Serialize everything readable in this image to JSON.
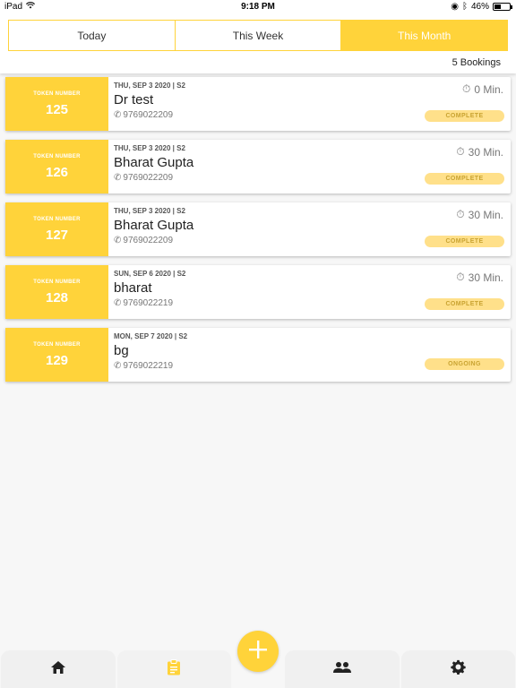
{
  "status": {
    "device": "iPad",
    "time": "9:18 PM",
    "battery": "46%"
  },
  "tabs": [
    {
      "label": "Today",
      "active": false
    },
    {
      "label": "This Week",
      "active": false
    },
    {
      "label": "This Month",
      "active": true
    }
  ],
  "bookings_count": "5 Bookings",
  "token_label": "TOKEN NUMBER",
  "bookings": [
    {
      "token": "125",
      "date": "THU, SEP 3 2020 | S2",
      "name": "Dr test",
      "phone": "9769022209",
      "duration": "0 Min.",
      "status": "COMPLETE"
    },
    {
      "token": "126",
      "date": "THU, SEP 3 2020 | S2",
      "name": "Bharat Gupta",
      "phone": "9769022209",
      "duration": "30 Min.",
      "status": "COMPLETE"
    },
    {
      "token": "127",
      "date": "THU, SEP 3 2020 | S2",
      "name": "Bharat Gupta",
      "phone": "9769022209",
      "duration": "30 Min.",
      "status": "COMPLETE"
    },
    {
      "token": "128",
      "date": "SUN, SEP 6 2020 | S2",
      "name": "bharat",
      "phone": "9769022219",
      "duration": "30 Min.",
      "status": "COMPLETE"
    },
    {
      "token": "129",
      "date": "MON, SEP 7 2020 | S2",
      "name": "bg",
      "phone": "9769022219",
      "duration": "",
      "status": "ONGOING"
    }
  ],
  "colors": {
    "accent": "#ffd33a",
    "badge_bg": "#ffe08a",
    "badge_text": "#c9a331"
  },
  "nav": [
    "home-icon",
    "clipboard-icon",
    "add-icon",
    "group-icon",
    "settings-icon"
  ]
}
